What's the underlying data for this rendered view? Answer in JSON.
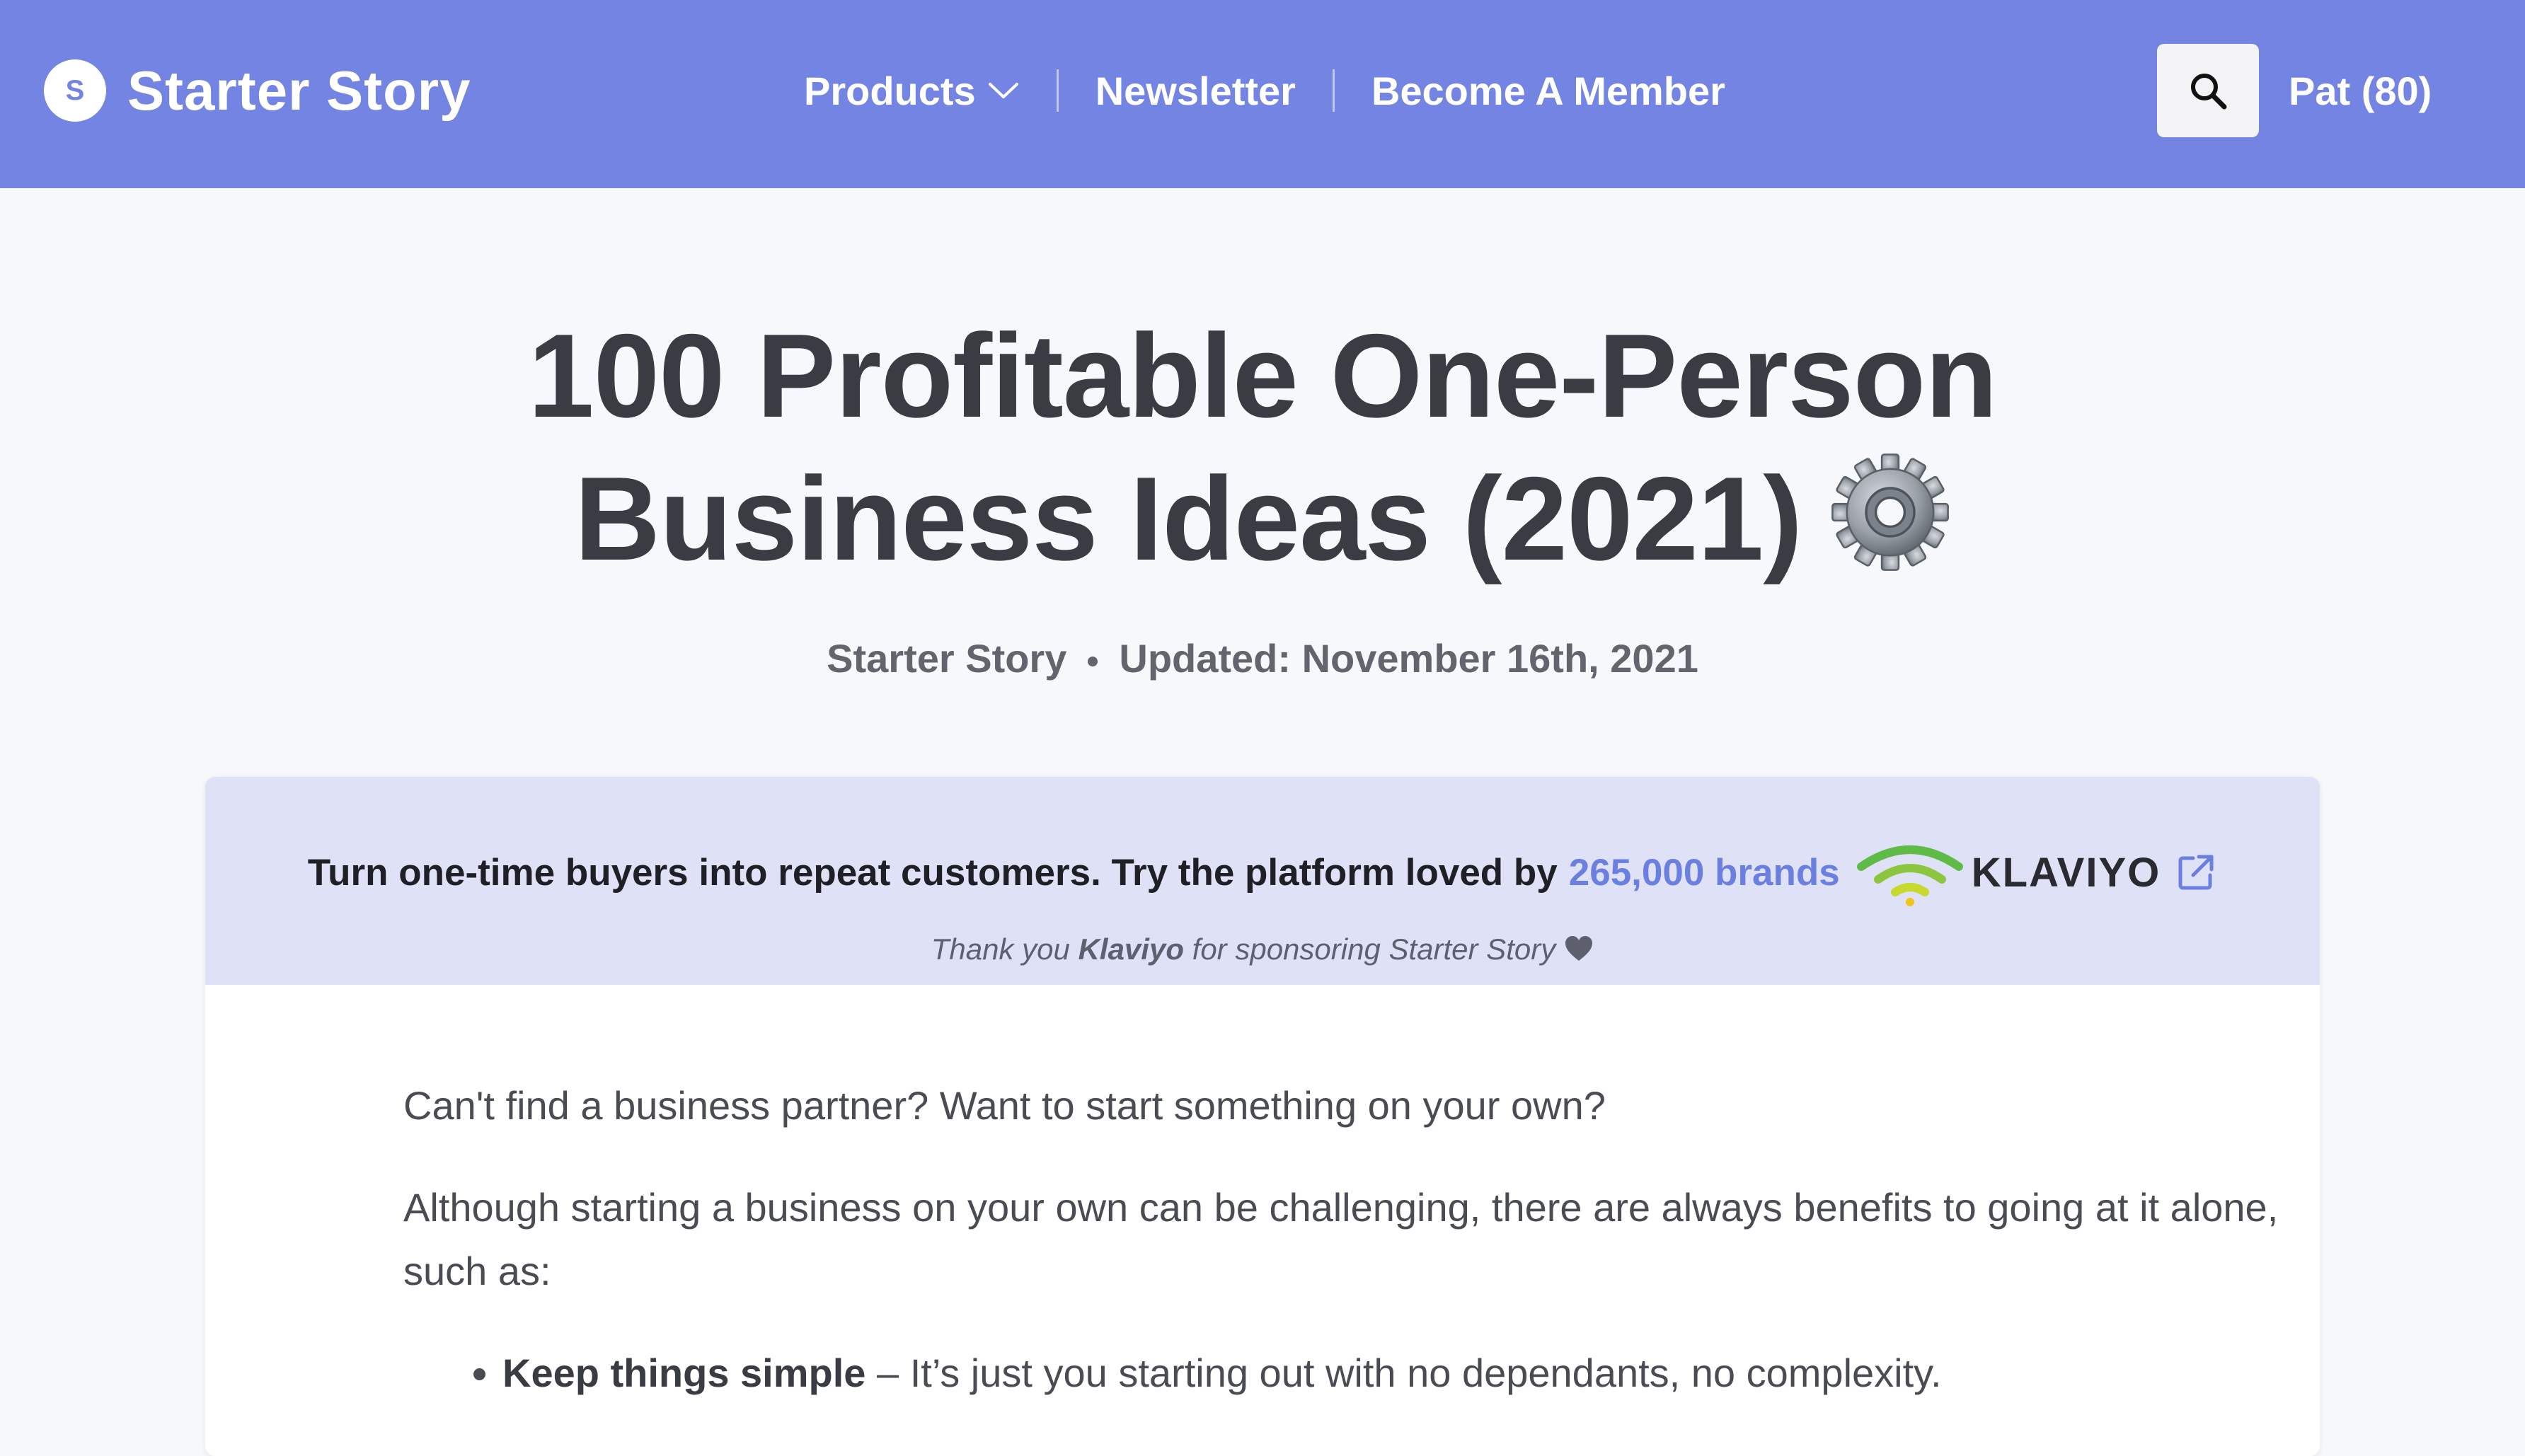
{
  "header": {
    "logo_letter": "S",
    "brand": "Starter Story",
    "nav": {
      "products": "Products",
      "newsletter": "Newsletter",
      "membership": "Become A Member"
    },
    "user": "Pat (80)"
  },
  "article": {
    "title_line_1": "100 Profitable One-Person",
    "title_line_2": "Business Ideas (2021)",
    "title_emoji": "gear-icon",
    "author": "Starter Story",
    "updated": "Updated: November 16th, 2021"
  },
  "sponsor": {
    "text": "Turn one-time buyers into repeat customers. Try the platform loved by",
    "highlight": "265,000 brands",
    "brand_wordmark": "KLAVIYO",
    "thanks_prefix": "Thank you",
    "thanks_brand": "Klaviyo",
    "thanks_suffix": "for sponsoring Starter Story"
  },
  "body": {
    "intro": "Can't find a business partner? Want to start something on your own?",
    "lead": "Although starting a business on your own can be challenging, there are always benefits to going at it alone, such as:",
    "bullets": [
      {
        "strong": "Keep things simple",
        "text": " – It’s just you starting out with no dependants, no complexity."
      }
    ]
  },
  "colors": {
    "header_bg": "#7384e2",
    "page_bg": "#f7f8fb",
    "sponsor_bg": "#dfe1f6",
    "accent": "#6b7fe0",
    "title_text": "#3a3c44"
  }
}
